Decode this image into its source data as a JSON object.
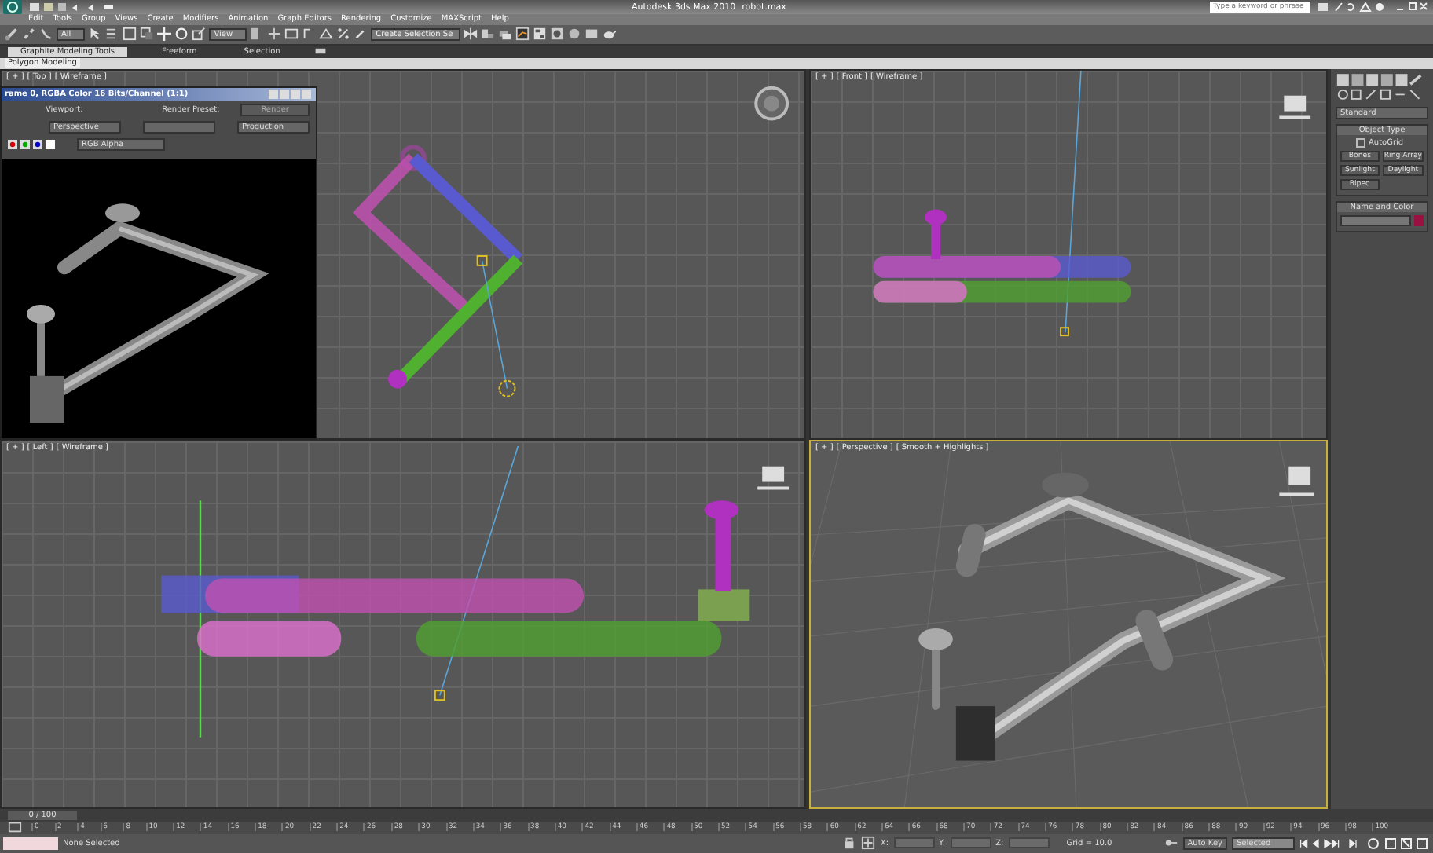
{
  "title_bar": {
    "app_title": "Autodesk 3ds Max 2010",
    "file_name": "robot.max",
    "search": {
      "placeholder": "Type a keyword or phrase"
    }
  },
  "menu": [
    "Edit",
    "Tools",
    "Group",
    "Views",
    "Create",
    "Modifiers",
    "Animation",
    "Graph Editors",
    "Rendering",
    "Customize",
    "MAXScript",
    "Help"
  ],
  "toolbar": {
    "selection_filter": "All",
    "reference_coord": "View",
    "named_selection": "Create Selection Se"
  },
  "ribbon": {
    "tabs": [
      {
        "label": "Graphite Modeling Tools",
        "selected": true
      },
      {
        "label": "Freeform",
        "selected": false
      },
      {
        "label": "Selection",
        "selected": false
      }
    ],
    "panel": "Polygon Modeling"
  },
  "viewports": [
    {
      "kind": "top",
      "active": false,
      "labels": [
        "[ + ]",
        "[ Top ]",
        "[ Wireframe ]"
      ]
    },
    {
      "kind": "front",
      "active": false,
      "labels": [
        "[ + ]",
        "[ Front ]",
        "[ Wireframe ]"
      ]
    },
    {
      "kind": "left",
      "active": false,
      "labels": [
        "[ + ]",
        "[ Left ]",
        "[ Wireframe ]"
      ]
    },
    {
      "kind": "perspective",
      "active": true,
      "labels": [
        "[ + ]",
        "[ Perspective ]",
        "[ Smooth + Highlights ]"
      ]
    }
  ],
  "render_window": {
    "title": "rame 0, RGBA Color 16 Bits/Channel (1:1)",
    "viewport_label": "Viewport:",
    "viewport": "Perspective",
    "preset_label": "Render Preset:",
    "render_button": "Render",
    "production": "Production",
    "channel": "RGB Alpha"
  },
  "command_panel": {
    "category": "Standard",
    "object_type": {
      "title": "Object Type",
      "autogrid": {
        "label": "AutoGrid",
        "checked": false
      },
      "buttons": [
        "Bones",
        "Ring Array",
        "Sunlight",
        "Daylight",
        "Biped"
      ]
    },
    "name_and_color": {
      "title": "Name and Color",
      "color": "#9a1040"
    }
  },
  "timeline": {
    "frame": "0 / 100",
    "level": 0,
    "ticks": [
      "0",
      "2",
      "4",
      "6",
      "8",
      "10",
      "12",
      "14",
      "16",
      "18",
      "20",
      "22",
      "24",
      "26",
      "28",
      "30",
      "32",
      "34",
      "36",
      "38",
      "40",
      "42",
      "44",
      "46",
      "48",
      "50",
      "52",
      "54",
      "56",
      "58",
      "60",
      "62",
      "64",
      "66",
      "68",
      "70",
      "72",
      "74",
      "76",
      "78",
      "80",
      "82",
      "84",
      "86",
      "88",
      "90",
      "92",
      "94",
      "96",
      "98",
      "100"
    ]
  },
  "status_bar": {
    "selection": "None Selected",
    "x_label": "X:",
    "y_label": "Y:",
    "z_label": "Z:",
    "grid": "Grid = 10.0",
    "auto_key": "Auto Key",
    "key_filter": "Selected"
  }
}
